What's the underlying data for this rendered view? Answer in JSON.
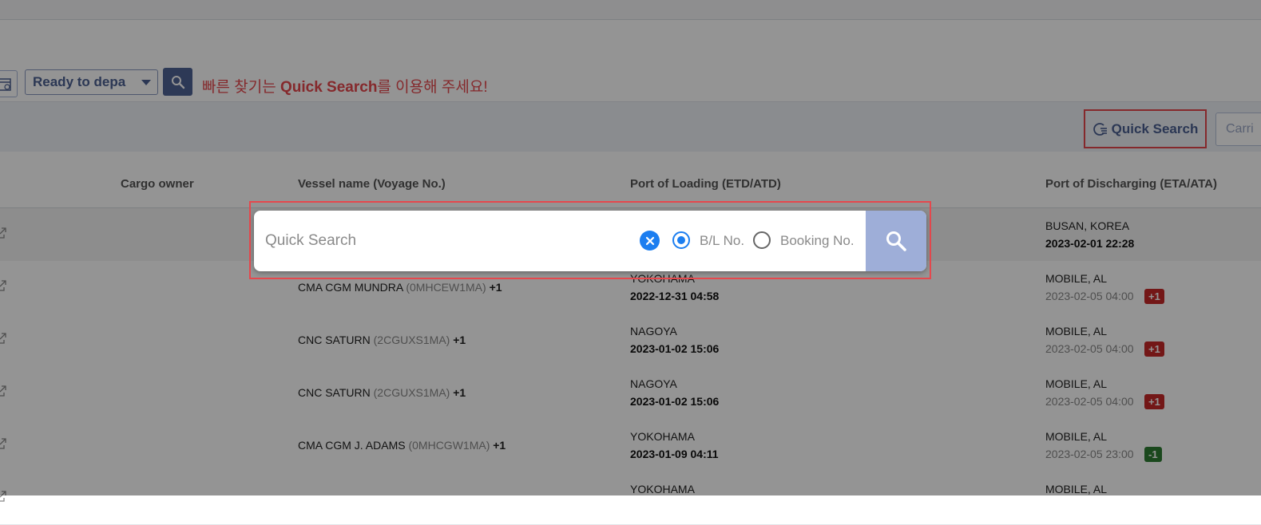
{
  "filter": {
    "status_value": "Ready to depa",
    "hint_prefix": "빠른 찾기는 ",
    "hint_bold": "Quick Search",
    "hint_suffix": "를 이용해 주세요!"
  },
  "toolbar": {
    "quick_search_label": "Quick Search",
    "carrier_label": "Carri"
  },
  "table": {
    "headers": {
      "cargo_owner": "Cargo owner",
      "vessel": "Vessel name (Voyage No.)",
      "pol": "Port of Loading (ETD/ATD)",
      "pod": "Port of Discharging (ETA/ATA)"
    },
    "rows": [
      {
        "vessel": "",
        "code": "",
        "plus": "",
        "pol_port": "",
        "pol_date": "",
        "pod_port": "BUSAN, KOREA",
        "pod_date": "2023-02-01 22:28",
        "badge": ""
      },
      {
        "vessel": "CMA CGM MUNDRA ",
        "code": "(0MHCEW1MA)",
        "plus": " +1",
        "pol_port": "YOKOHAMA",
        "pol_date": "2022-12-31 04:58",
        "pod_port": "MOBILE, AL",
        "pod_date": "2023-02-05 04:00",
        "badge": "+1"
      },
      {
        "vessel": "CNC SATURN ",
        "code": "(2CGUXS1MA)",
        "plus": " +1",
        "pol_port": "NAGOYA",
        "pol_date": "2023-01-02 15:06",
        "pod_port": "MOBILE, AL",
        "pod_date": "2023-02-05 04:00",
        "badge": "+1"
      },
      {
        "vessel": "CNC SATURN ",
        "code": "(2CGUXS1MA)",
        "plus": " +1",
        "pol_port": "NAGOYA",
        "pol_date": "2023-01-02 15:06",
        "pod_port": "MOBILE, AL",
        "pod_date": "2023-02-05 04:00",
        "badge": "+1"
      },
      {
        "vessel": "CMA CGM J. ADAMS ",
        "code": "(0MHCGW1MA)",
        "plus": " +1",
        "pol_port": "YOKOHAMA",
        "pol_date": "2023-01-09 04:11",
        "pod_port": "MOBILE, AL",
        "pod_date": "2023-02-05 23:00",
        "badge": "-1"
      },
      {
        "vessel": "",
        "code": "",
        "plus": "",
        "pol_port": "YOKOHAMA",
        "pol_date": "",
        "pod_port": "MOBILE, AL",
        "pod_date": "",
        "badge": ""
      }
    ]
  },
  "quick_search_modal": {
    "placeholder": "Quick Search",
    "option_bl": "B/L No.",
    "option_booking": "Booking No.",
    "selected": "B/L No."
  },
  "colors": {
    "accent": "#4a5f91",
    "highlight_red": "#e5484d",
    "radio_blue": "#1c7ef0",
    "badge_red": "#c62828",
    "badge_green": "#2e7d32"
  }
}
